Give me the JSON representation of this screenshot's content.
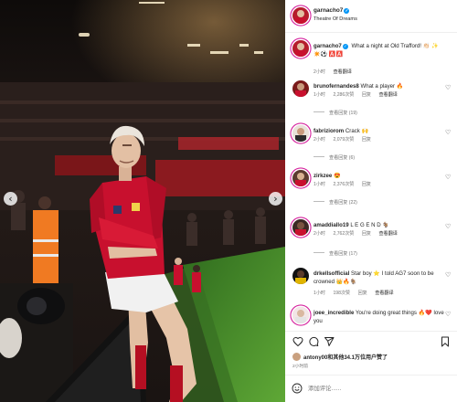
{
  "post": {
    "username": "garnacho7",
    "location": "Theatre Of Dreams",
    "caption_text": "What a night at Old Trafford! 👏🏻 ✨",
    "caption_emojis": "✴️⚽️ 🅰️🅰️",
    "caption_time": "2小时",
    "caption_translate": "查看翻译"
  },
  "comments": [
    {
      "username": "brunofernandes8",
      "text": "What a player 🔥",
      "time": "1小时",
      "likes": "2,286次赞",
      "reply": "回复",
      "translate": "查看翻译",
      "replies": "查看回复 (19)"
    },
    {
      "username": "fabriziorom",
      "text": "Crack 🙌",
      "time": "2小时",
      "likes": "2,079次赞",
      "reply": "回复",
      "translate": "",
      "replies": "查看回复 (6)"
    },
    {
      "username": "zirkzee",
      "text": "😍",
      "time": "1小时",
      "likes": "2,376次赞",
      "reply": "回复",
      "translate": "",
      "replies": "查看回复 (22)"
    },
    {
      "username": "amaddiallo19",
      "text": "L E G E N D 🐐",
      "time": "2小时",
      "likes": "2,762次赞",
      "reply": "回复",
      "translate": "查看翻译",
      "replies": "查看回复 (17)"
    },
    {
      "username": "drkellsofficial",
      "text": "Star boy ⭐ I told AG7 soon to be crowned 👑🔥🐐",
      "time": "1小时",
      "likes": "198次赞",
      "reply": "回复",
      "translate": "查看翻译",
      "replies": ""
    },
    {
      "username": "joee_incredible",
      "text": "You're doing great things 🔥❤️ love you",
      "time": "",
      "likes": "",
      "reply": "",
      "translate": "",
      "replies": ""
    }
  ],
  "footer": {
    "likes_text": "antony00和其他34.1万位用户赞了",
    "time": "2小时前",
    "comment_placeholder": "添加评论......"
  },
  "colors": {
    "accent": "#0095f6",
    "story_ring": "#d6249f",
    "muted": "#737373",
    "text": "#262626",
    "kit_red": "#c8102e"
  },
  "icons": {
    "photo_prev": "chevron-left-icon",
    "photo_next": "chevron-right-icon",
    "heart": "heart-icon",
    "comment": "comment-icon",
    "share": "send-icon",
    "save": "bookmark-icon",
    "emoji": "emoji-icon"
  }
}
